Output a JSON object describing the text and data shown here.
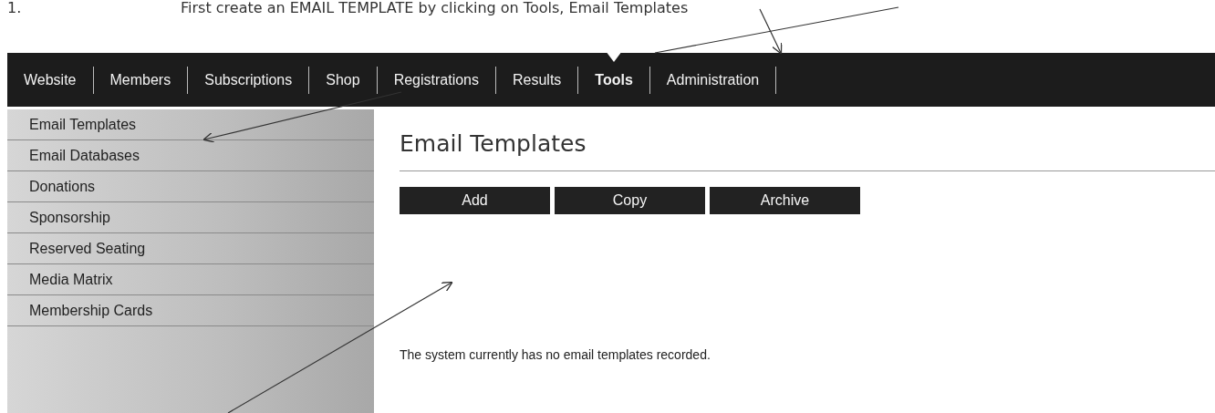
{
  "instruction": {
    "number": "1.",
    "text": "First create an EMAIL TEMPLATE by clicking on Tools, Email Templates"
  },
  "nav": [
    {
      "label": "Website",
      "selected": false
    },
    {
      "label": "Members",
      "selected": false
    },
    {
      "label": "Subscriptions",
      "selected": false
    },
    {
      "label": "Shop",
      "selected": false
    },
    {
      "label": "Registrations",
      "selected": false
    },
    {
      "label": "Results",
      "selected": false
    },
    {
      "label": "Tools",
      "selected": true
    },
    {
      "label": "Administration",
      "selected": false
    }
  ],
  "sidebar": {
    "items": [
      "Email Templates",
      "Email Databases",
      "Donations",
      "Sponsorship",
      "Reserved Seating",
      "Media Matrix",
      "Membership Cards"
    ]
  },
  "content": {
    "title": "Email Templates",
    "buttons": [
      "Add",
      "Copy",
      "Archive"
    ],
    "message": "The system currently has no email templates recorded."
  }
}
